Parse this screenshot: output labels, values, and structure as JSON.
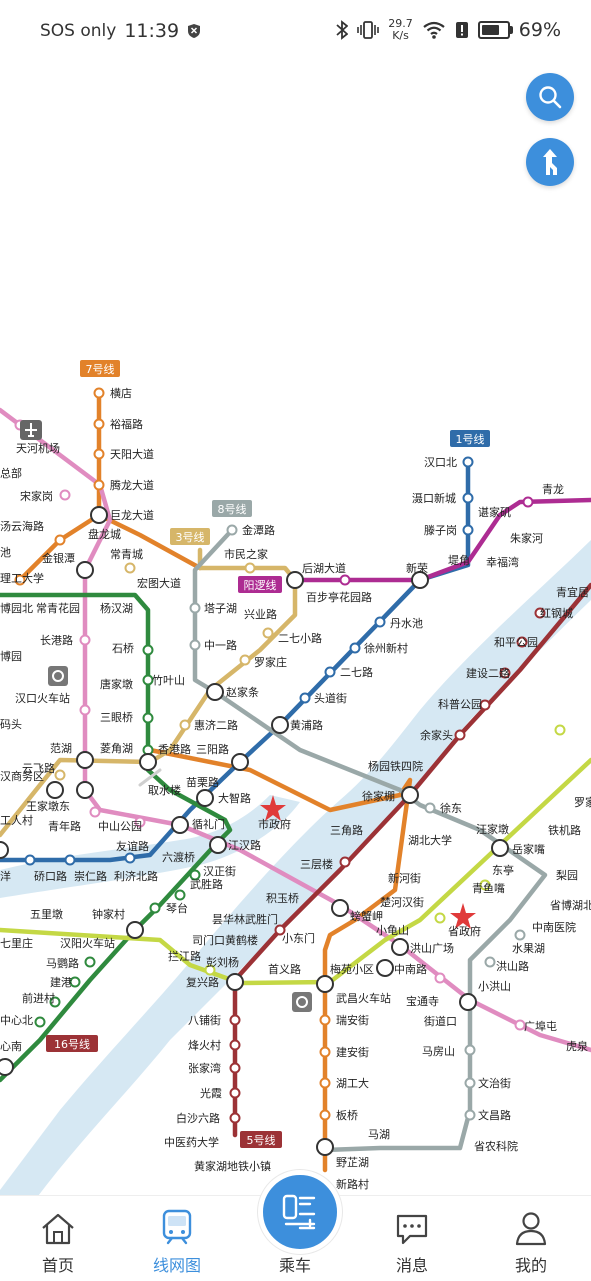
{
  "status_bar": {
    "carrier": "SOS only",
    "time": "11:39",
    "net_speed_value": "29.7",
    "net_speed_unit": "K/s",
    "battery": "69%",
    "battery_level": 0.69
  },
  "map": {
    "line_labels": {
      "l1": "1号线",
      "l3": "3号线",
      "l5": "5号线",
      "l7": "7号线",
      "l8": "8号线",
      "l16": "16号线",
      "yangluo": "阳逻线"
    },
    "stations": {
      "hengdian": "横店",
      "yufulu": "裕福路",
      "tianyangdadao": "天阳大道",
      "tenglongdadao": "腾龙大道",
      "julongdadao": "巨龙大道",
      "panlongcheng": "盘龙城",
      "changqingcheng": "常青城",
      "hongtudadao": "宏图大道",
      "tianhejichang": "天河机场",
      "songjiagang": "宋家岗",
      "hanyunhailu": "汤云海路",
      "jinyinhu": "金银潭",
      "zongbu": "总部",
      "chi": "池",
      "ligongdaxue": "理工大学",
      "bowuyuanbei": "博园北",
      "changqinghuayuan": "常青花园",
      "yanghanhu": "杨汉湖",
      "changganglu": "长港路",
      "shiqiao": "石桥",
      "bowuyuan": "博园",
      "tangjiadun": "唐家墩",
      "sanyanqiao": "三眼桥",
      "hankouhuochezhan": "汉口火车站",
      "matou": "码头",
      "fanhu": "范湖",
      "lingjiaohu": "菱角湖",
      "yunfeilu": "云飞路",
      "hanshangwuqu": "汉商务区",
      "wangjiadun": "王家墩东",
      "qushuilou": "取水楼",
      "qingnianlu": "青年路",
      "zhongshangongyuan": "中山公园",
      "xunlimen": "循礼门",
      "dazhilu": "大智路",
      "jianghanlu": "江汉路",
      "youyilu": "友谊路",
      "liuduqiao": "六渡桥",
      "hanzhengjie": "汉正街",
      "wushenglu": "武胜路",
      "qintai": "琴台",
      "zhongjiacun": "钟家村",
      "hanyanghuochezhan": "汉阳火车站",
      "maoyinlu": "马鹦路",
      "jiangang": "建港",
      "qianjinlu": "前进村",
      "zhongxinbei": "中心北",
      "xinan": "心南",
      "wulidun": "五里墩",
      "qilizhuang": "七里庄",
      "yangyang": "洋",
      "qiaokoulu": "硚口路",
      "chongrenlu": "崇仁路",
      "lijibeilu": "利济北路",
      "gongrencun": "工人村",
      "zhuyeshan": "竹叶山",
      "zhaojiatiao": "赵家条",
      "tazihu": "塔子湖",
      "zhongyilu": "中一路",
      "jintanlu": "金潭路",
      "shiminzhijia": "市民之家",
      "houhudadao": "后湖大道",
      "xinglonglu": "兴业路",
      "erqixiaolu": "二七小路",
      "luojiazhuang": "罗家庄",
      "huijierlu": "惠济二路",
      "xianggang": "香港路",
      "sanyanglu": "三阳路",
      "miaolilu": "苗栗路",
      "shizhengfu": "市政府",
      "huangpulu": "黄浦路",
      "toudaojie": "头道街",
      "erqilu": "二七路",
      "xuzhouxincun": "徐州新村",
      "danshuichi": "丹水池",
      "xinrong": "新荣",
      "dixiao": "堤角",
      "hankoubei": "汉口北",
      "tankouxincheng": "滠口新城",
      "tengzigang": "滕子岗",
      "xingfuwan": "幸福湾",
      "zhujiahe": "朱家河",
      "tanjiaji": "谌家矶",
      "qinglong": "青龙",
      "baibuting": "百步亭花园路",
      "qingyiju": "青宜居",
      "honggangcheng": "红钢城",
      "hepinggongyuan": "和平公园",
      "jianshe2lu": "建设二路",
      "kepugongyuan": "科普公园",
      "yujiatou": "余家头",
      "yangyuantiesi": "杨园铁四院",
      "xujiapeng": "徐家棚",
      "sanjiaolu": "三角路",
      "hubeidaxue": "湖北大学",
      "xudong": "徐东",
      "wangjiadun2": "汪家墩",
      "yuejiazui": "岳家嘴",
      "tieji": "铁机路",
      "luoyang": "罗家",
      "dongting": "东亭",
      "qingyuzui": "青鱼嘴",
      "liyuan": "梨园",
      "shengbowu": "省博湖北",
      "zhongnanyiyuan": "中南医院",
      "shengzhengfu": "省政府",
      "chuhehanjie": "楚河汉街",
      "xinhejie": "新河街",
      "sancenglou": "三层楼",
      "jiyuqiao": "积玉桥",
      "pangxiejia": "螃蟹岬",
      "xiaoguishan": "小龟山",
      "hongshanguangchang": "洪山广场",
      "zhongnanlu": "中南路",
      "shuiguohu": "水果湖",
      "hongshanlu": "洪山路",
      "xiaohongshan": "小洪山",
      "jiedaokou": "街道口",
      "guangbutun": "广埠屯",
      "huquan": "虎泉",
      "baotongsi": "宝通寺",
      "mafangshan": "马房山",
      "wenzhijie": "文治街",
      "wenchang": "文昌路",
      "shengnongkeyuan": "省农科院",
      "yunhualinqiao": "昙华林武胜门",
      "simenkou": "司门口黄鹤楼",
      "xiaodongmen": "小东门",
      "pengliuyang": "彭刘杨",
      "shouyilu": "首义路",
      "meiyuanxiaoqu": "梅苑小区",
      "wuchanghuochezhan": "武昌火车站",
      "fuxinglu": "复兴路",
      "lanjianglu": "拦江路",
      "bapujie": "八铺街",
      "fenghuocun": "烽火村",
      "zhangjiawan": "张家湾",
      "guangxia": "光霞",
      "baishaliulu": "白沙六路",
      "zhongyiyaodaxue": "中医药大学",
      "huangjiahu": "黄家湖地铁小镇",
      "ruianjie": "瑞安街",
      "jiananjie": "建安街",
      "hugongda": "湖工大",
      "banqiao": "板桥",
      "yezhihu": "野芷湖",
      "xinlucun": "新路村",
      "mahu": "马湖"
    }
  },
  "tabs": {
    "home": "首页",
    "network": "线网图",
    "ride": "乘车",
    "messages": "消息",
    "mine": "我的"
  },
  "colors": {
    "accent": "#3d8fdc",
    "line1": "#2f6ca9",
    "line2": "#e08cc0",
    "line3": "#d6b669",
    "line4": "#2f8a3e",
    "line5": "#9c3236",
    "line6": "#d5d5d5",
    "line7": "#e2822a",
    "line8": "#9aa8a8",
    "line11": "#c4d845",
    "line21": "#ad2c92",
    "river": "#d6e8f3"
  }
}
